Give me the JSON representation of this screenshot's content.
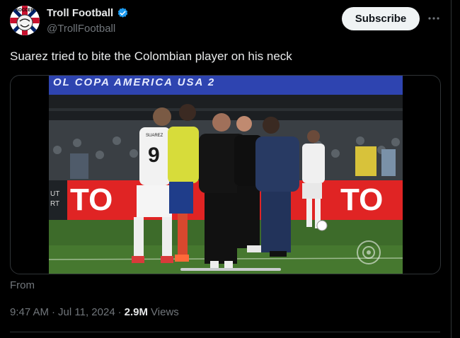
{
  "author": {
    "display_name": "Troll Football",
    "handle": "@TrollFootball",
    "avatar_text": "SOCCER",
    "verified_icon": "verified-badge-icon",
    "verified_color": "#1d9bf0"
  },
  "actions": {
    "subscribe_label": "Subscribe",
    "more_icon": "more-horizontal-icon"
  },
  "tweet": {
    "text": "Suarez tried to bite the Colombian player on his neck",
    "from_label": "From",
    "time": "9:47 AM",
    "separator_1": "·",
    "date": "Jul 11, 2024",
    "separator_2": "·",
    "views_count": "2.9M",
    "views_label": "Views"
  },
  "video": {
    "banner_text": "OL COPA AMERICA USA 2",
    "ad_board_text": "TO",
    "ad_board_text_2": "TO",
    "side_text_1": "UT",
    "side_text_2": "RT",
    "jersey_number": "9",
    "jersey_name": "SUAREZ",
    "watermark_icon": "broadcaster-logo-icon",
    "pitch_color": "#3d6b2a",
    "ad_color": "#e02424"
  }
}
